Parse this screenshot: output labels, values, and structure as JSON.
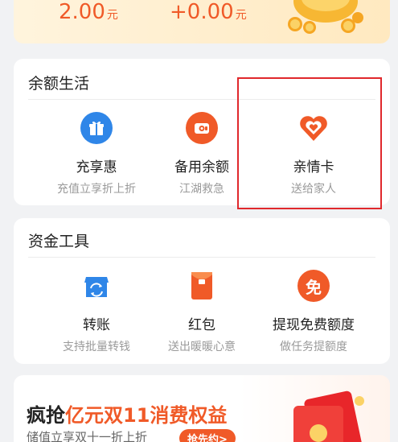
{
  "balance": {
    "amount_left": "2.00",
    "amount_right": "+0.00",
    "unit": "元"
  },
  "life_section": {
    "title": "余额生活",
    "items": [
      {
        "label": "充享惠",
        "sub": "充值立享折上折",
        "icon": "gift-icon",
        "color": "#2f86e8"
      },
      {
        "label": "备用余额",
        "sub": "江湖救急",
        "icon": "wallet-icon",
        "color": "#f05a28"
      },
      {
        "label": "亲情卡",
        "sub": "送给家人",
        "icon": "heart-icon",
        "color": "#f05a28"
      }
    ]
  },
  "tools_section": {
    "title": "资金工具",
    "items": [
      {
        "label": "转账",
        "sub": "支持批量转钱",
        "icon": "transfer-shop-icon",
        "color": "#2f86e8"
      },
      {
        "label": "红包",
        "sub": "送出暖暖心意",
        "icon": "red-packet-icon",
        "color": "#f05a28"
      },
      {
        "label": "提现免费额度",
        "sub": "做任务提额度",
        "icon": "free-badge-icon",
        "color": "#f05a28",
        "glyph": "免"
      }
    ]
  },
  "promo": {
    "title_prefix": "疯抢",
    "title_highlight": "亿元双11消费权益",
    "subtitle": "储值立享双十一折上折",
    "button": "抢先约>"
  }
}
